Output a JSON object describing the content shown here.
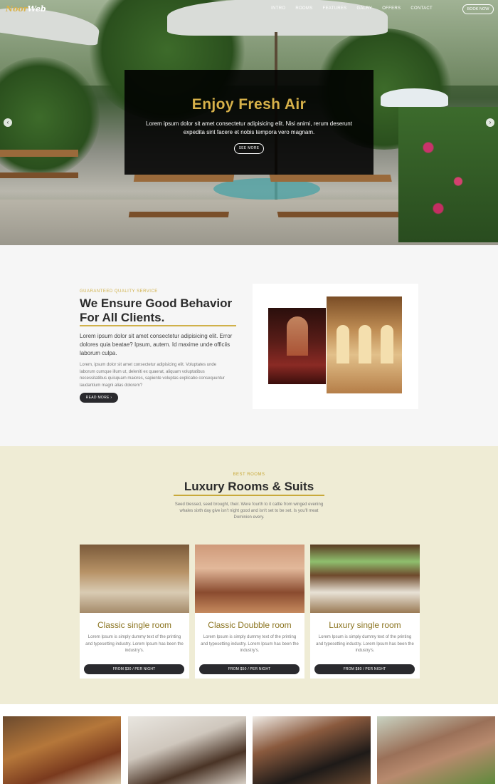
{
  "brand": {
    "logo_part1": "Noor",
    "logo_part2": "Web"
  },
  "nav": {
    "items": [
      {
        "label": "INTRO"
      },
      {
        "label": "ROOMS"
      },
      {
        "label": "FEATURES"
      },
      {
        "label": "GALRY"
      },
      {
        "label": "OFFERS"
      },
      {
        "label": "CONTACT"
      }
    ],
    "book_label": "BOOK NOW"
  },
  "hero": {
    "title": "Enjoy Fresh Air",
    "text": "Lorem ipsum dolor sit amet consectetur adipisicing elit. Nisi animi, rerum deserunt expedita sint facere et nobis tempora vero magnam.",
    "button": "SEE MORE",
    "prev_icon": "chevron-left-icon",
    "next_icon": "chevron-right-icon"
  },
  "about": {
    "eyebrow": "GUARANTEED QUALITY SERVICE",
    "title": "We Ensure Good Behavior For All Clients.",
    "lead": "Lorem ipsum dolor sit amet consectetur adipisicing elit. Error dolores quia beatae? Ipsum, autem. Id maxime unde officiis laborum culpa.",
    "text": "Lorem, ipsum dolor sit amet consectetur adipisicing elit. Voluptates unde laborum cumque illum ut, deleniti ex quaerat, aliquam voluptatibus necessitatibus quisquam maiores, sapiente voluptas explicabo consequuntur laudantium magni alias dolorem?",
    "button": "READ MORE",
    "button_icon": "chevron-right-icon"
  },
  "rooms": {
    "eyebrow": "BEST ROOMS",
    "title": "Luxury Rooms & Suits",
    "intro": "Seed blessed, seed brought, their. Were fourth to it cattle from winged evening whales sixth day give isn't night good and isn't set to be set. Is you'll meat Dominion every.",
    "cards": [
      {
        "title": "Classic single room",
        "text": "Lorem Ipsum is simply dummy text of the printing and typesetting industry. Lorem Ipsum has been the industry's.",
        "price": "FROM $30 / PER NIGHT"
      },
      {
        "title": "Classic Doubble room",
        "text": "Lorem Ipsum is simply dummy text of the printing and typesetting industry. Lorem Ipsum has been the industry's.",
        "price": "FROM $50 / PER NIGHT"
      },
      {
        "title": "Luxury single room",
        "text": "Lorem Ipsum is simply dummy text of the printing and typesetting industry. Lorem Ipsum has been the industry's.",
        "price": "FROM $80 / PER NIGHT"
      }
    ]
  },
  "colors": {
    "accent": "#d8b24a",
    "dark": "#2a2a2e",
    "rooms_bg": "#efecd5",
    "about_bg": "#f6f6f6"
  }
}
